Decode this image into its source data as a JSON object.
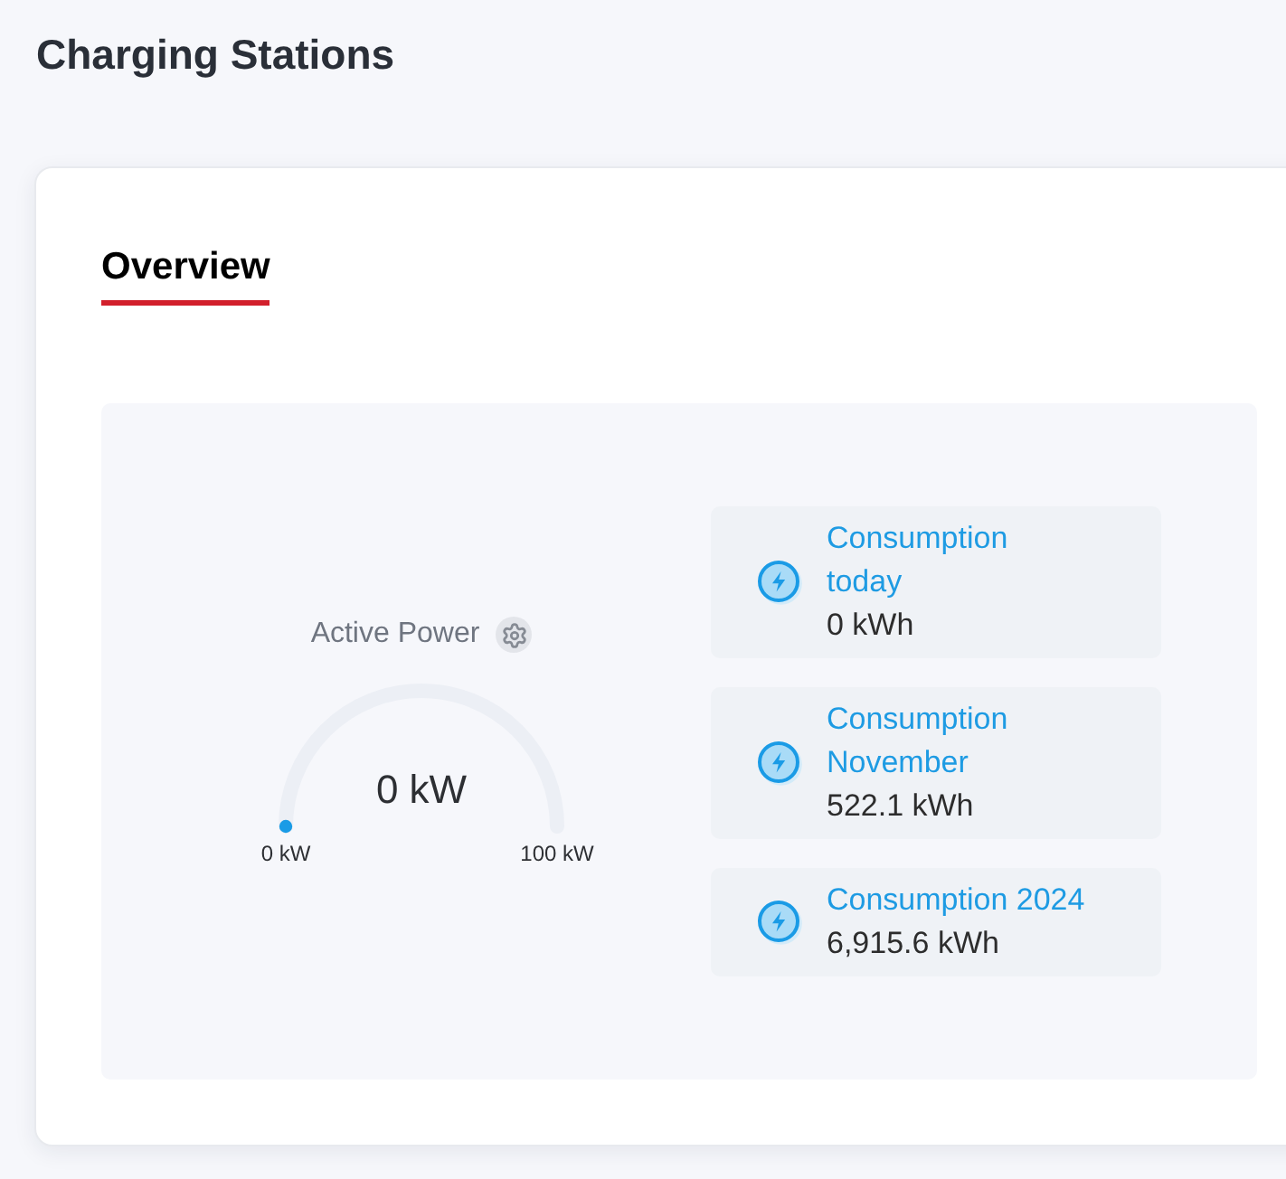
{
  "page": {
    "title": "Charging Stations"
  },
  "tabs": [
    {
      "label": "Overview",
      "selected": true
    }
  ],
  "gauge": {
    "label": "Active Power",
    "value": "0 kW",
    "level": 0,
    "min_label": "0 kW",
    "max_label": "100 kW"
  },
  "stats": [
    {
      "label": "Consumption today",
      "value": "0 kWh"
    },
    {
      "label": "Consumption November",
      "value": "522.1 kWh"
    },
    {
      "label": "Consumption 2024",
      "value": "6,915.6 kWh"
    }
  ]
}
